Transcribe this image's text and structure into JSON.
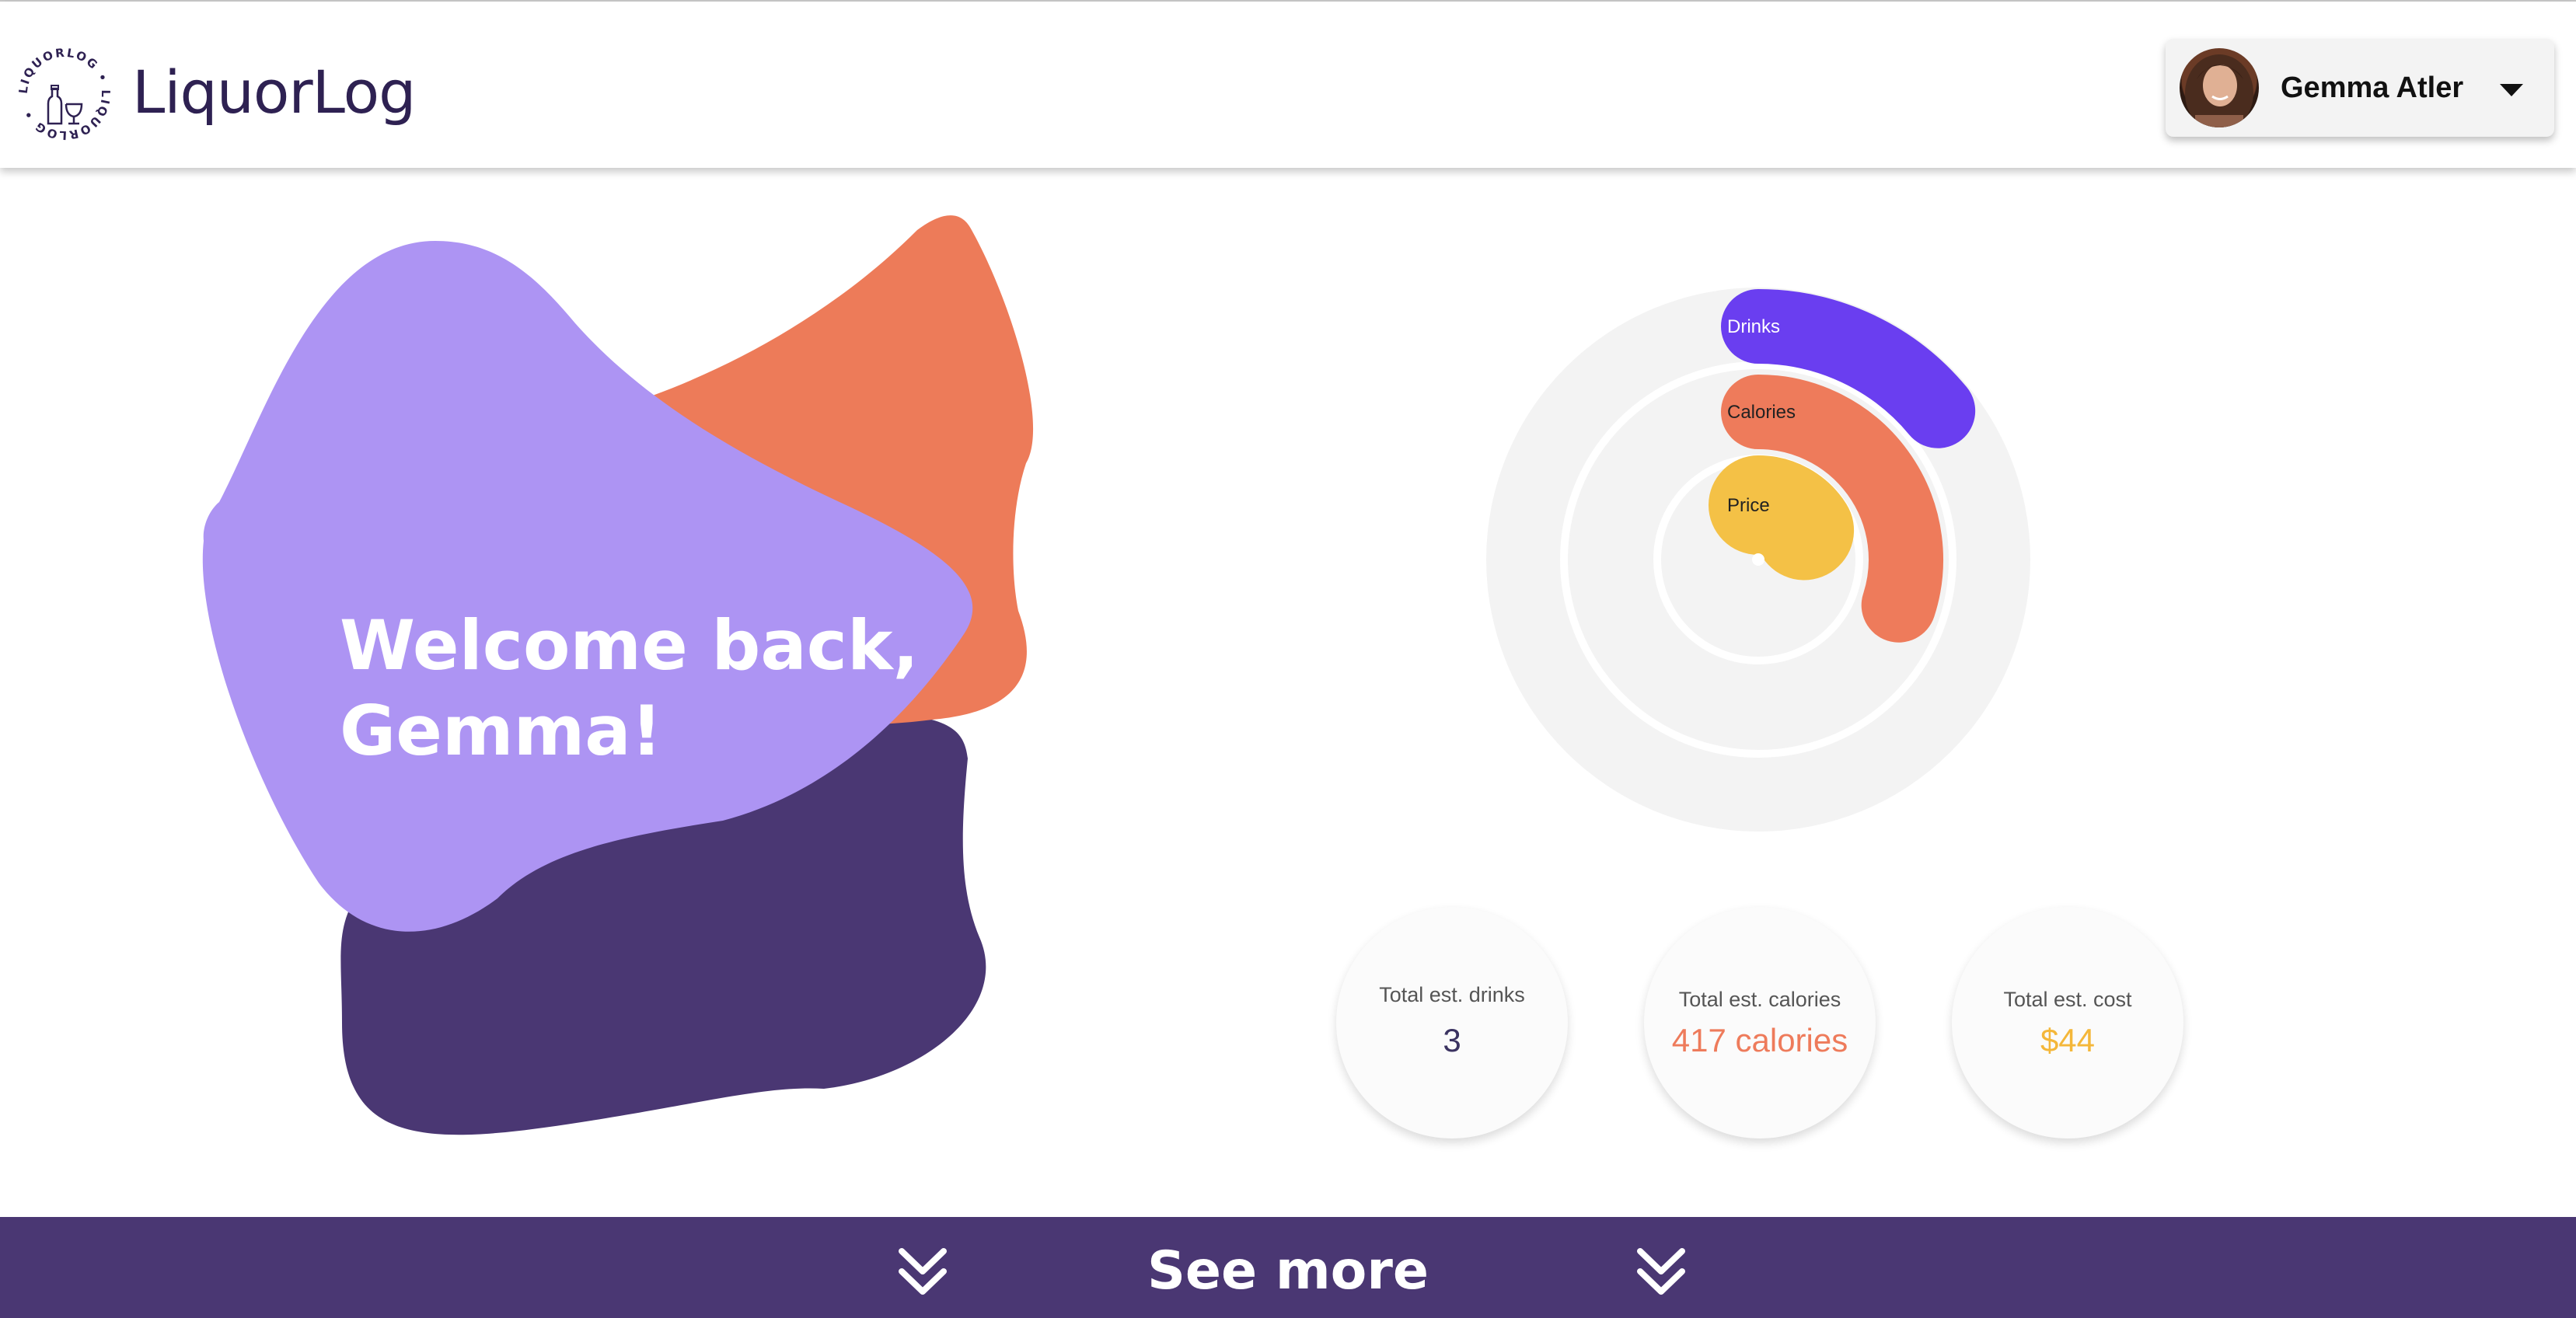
{
  "app": {
    "brand": "LiquorLog",
    "logo_ring_text": "LIQUORLOG • LIQUORLOG •"
  },
  "user": {
    "name": "Gemma Atler"
  },
  "hero": {
    "welcome_line1": "Welcome back,",
    "welcome_line2": "Gemma!"
  },
  "chart_data": {
    "type": "radial-bar",
    "series": [
      {
        "name": "Drinks",
        "color": "#6a3ef0",
        "fraction": 0.14
      },
      {
        "name": "Calories",
        "color": "#ee7b5b",
        "fraction": 0.3
      },
      {
        "name": "Price",
        "color": "#f4c146",
        "fraction": 0.16
      }
    ]
  },
  "stats": [
    {
      "label": "Total est. drinks",
      "value": "3",
      "color": "#3b3361"
    },
    {
      "label": "Total est. calories",
      "value": "417 calories",
      "color": "#ee7b5b"
    },
    {
      "label": "Total est. cost",
      "value": "$44",
      "color": "#f4b73a"
    }
  ],
  "footer": {
    "see_more": "See more"
  },
  "colors": {
    "lavender": "#ad94f3",
    "orange": "#ed7b59",
    "purple_dark": "#4a3773",
    "track": "#f3f3f3"
  }
}
